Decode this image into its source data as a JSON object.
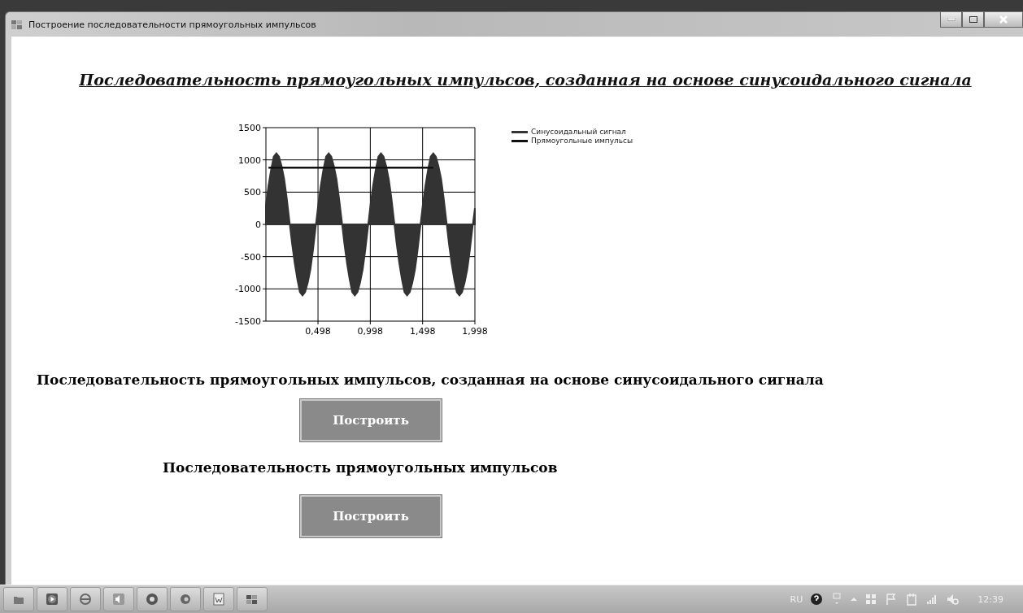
{
  "window": {
    "title": "Построение последовательности прямоугольных импульсов"
  },
  "heading": "Последовательность прямоугольных импульсов, созданная на основе синусоидального сигнала",
  "chart": {
    "chart_data": {
      "type": "line",
      "grid": true,
      "xlim": [
        0,
        1.998
      ],
      "ylim": [
        -1500,
        1500
      ],
      "xticks": [
        {
          "value": 0.498,
          "label": "0,498"
        },
        {
          "value": 0.998,
          "label": "0,998"
        },
        {
          "value": 1.498,
          "label": "1,498"
        },
        {
          "value": 1.998,
          "label": "1,998"
        }
      ],
      "yticks": [
        -1500,
        -1000,
        -500,
        0,
        500,
        1000,
        1500
      ],
      "x": [
        0,
        0.025,
        0.05,
        0.075,
        0.1,
        0.125,
        0.15,
        0.175,
        0.2,
        0.225,
        0.25,
        0.275,
        0.3,
        0.325,
        0.35,
        0.375,
        0.4,
        0.425,
        0.45,
        0.475,
        0.5,
        0.525,
        0.55,
        0.575,
        0.6,
        0.625,
        0.65,
        0.675,
        0.7,
        0.725,
        0.75,
        0.775,
        0.8,
        0.825,
        0.85,
        0.875,
        0.9,
        0.925,
        0.95,
        0.975,
        1,
        1.025,
        1.05,
        1.075,
        1.1,
        1.125,
        1.15,
        1.175,
        1.2,
        1.225,
        1.25,
        1.275,
        1.3,
        1.325,
        1.35,
        1.375,
        1.4,
        1.425,
        1.45,
        1.475,
        1.5,
        1.525,
        1.55,
        1.575,
        1.6,
        1.625,
        1.65,
        1.675,
        1.7,
        1.725,
        1.75,
        1.775,
        1.8,
        1.825,
        1.85,
        1.875,
        1.9,
        1.925,
        1.95,
        1.975,
        1.998
      ],
      "series": [
        {
          "name": "Синусоидальный сигнал",
          "type": "area",
          "color": "#333333",
          "values": [
            300,
            600,
            850,
            1050,
            1100,
            1050,
            900,
            700,
            400,
            50,
            -300,
            -600,
            -850,
            -1050,
            -1100,
            -1050,
            -900,
            -700,
            -400,
            -50,
            300,
            600,
            850,
            1050,
            1100,
            1050,
            900,
            700,
            400,
            50,
            -300,
            -600,
            -850,
            -1050,
            -1100,
            -1050,
            -900,
            -700,
            -400,
            -50,
            300,
            600,
            850,
            1050,
            1100,
            1050,
            900,
            700,
            400,
            50,
            -300,
            -600,
            -850,
            -1050,
            -1100,
            -1050,
            -900,
            -700,
            -400,
            -50,
            300,
            600,
            850,
            1050,
            1100,
            1050,
            900,
            700,
            400,
            50,
            -300,
            -600,
            -850,
            -1050,
            -1100,
            -1050,
            -900,
            -700,
            -400,
            -50,
            250
          ]
        },
        {
          "name": "Прямоугольные импульсы",
          "color": "#111111",
          "values": [
            null,
            880,
            880,
            880,
            880,
            880,
            880,
            880,
            880,
            880,
            880,
            880,
            880,
            880,
            880,
            880,
            880,
            880,
            880,
            880,
            880,
            880,
            880,
            880,
            880,
            880,
            880,
            880,
            880,
            880,
            880,
            880,
            880,
            880,
            880,
            880,
            880,
            880,
            880,
            880,
            880,
            880,
            880,
            880,
            880,
            880,
            880,
            880,
            880,
            880,
            880,
            880,
            880,
            880,
            880,
            880,
            880,
            880,
            880,
            880,
            880,
            880,
            880,
            880,
            880,
            null,
            null,
            null,
            null,
            null,
            null,
            null,
            null,
            null,
            null,
            null,
            null,
            null,
            null,
            null,
            null
          ]
        }
      ]
    }
  },
  "sections": [
    {
      "label": "Последовательность прямоугольных импульсов, созданная на основе синусоидального сигнала",
      "button": "Построить"
    },
    {
      "label": "Последовательность прямоугольных импульсов",
      "button": "Построить"
    }
  ],
  "tray": {
    "language": "RU",
    "time": "12:39"
  }
}
